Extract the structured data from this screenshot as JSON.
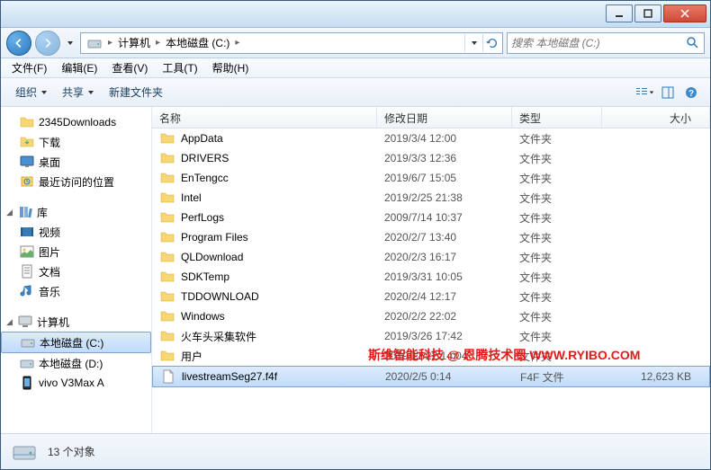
{
  "window_controls": {
    "min": "min",
    "max": "max",
    "close": "close"
  },
  "breadcrumb": {
    "root_sep": "▸",
    "computer": "计算机",
    "drive": "本地磁盘 (C:)"
  },
  "search": {
    "placeholder": "搜索 本地磁盘 (C:)"
  },
  "menubar": [
    "文件(F)",
    "编辑(E)",
    "查看(V)",
    "工具(T)",
    "帮助(H)"
  ],
  "toolbar": {
    "organize": "组织",
    "share": "共享",
    "new_folder": "新建文件夹"
  },
  "sidebar": {
    "group1": [
      {
        "icon": "folder",
        "label": "2345Downloads"
      },
      {
        "icon": "folder-dl",
        "label": "下载"
      },
      {
        "icon": "desktop",
        "label": "桌面"
      },
      {
        "icon": "recent",
        "label": "最近访问的位置"
      }
    ],
    "lib_header": "库",
    "libs": [
      {
        "icon": "video",
        "label": "视频"
      },
      {
        "icon": "pic",
        "label": "图片"
      },
      {
        "icon": "doc",
        "label": "文档"
      },
      {
        "icon": "music",
        "label": "音乐"
      }
    ],
    "computer_header": "计算机",
    "drives": [
      {
        "icon": "drive",
        "label": "本地磁盘 (C:)",
        "selected": true
      },
      {
        "icon": "drive",
        "label": "本地磁盘 (D:)"
      },
      {
        "icon": "phone",
        "label": "vivo V3Max A"
      }
    ]
  },
  "columns": {
    "name": "名称",
    "date": "修改日期",
    "type": "类型",
    "size": "大小"
  },
  "files": [
    {
      "name": "AppData",
      "date": "2019/3/4 12:00",
      "type": "文件夹",
      "size": "",
      "icon": "folder"
    },
    {
      "name": "DRIVERS",
      "date": "2019/3/3 12:36",
      "type": "文件夹",
      "size": "",
      "icon": "folder"
    },
    {
      "name": "EnTengcc",
      "date": "2019/6/7 15:05",
      "type": "文件夹",
      "size": "",
      "icon": "folder"
    },
    {
      "name": "Intel",
      "date": "2019/2/25 21:38",
      "type": "文件夹",
      "size": "",
      "icon": "folder"
    },
    {
      "name": "PerfLogs",
      "date": "2009/7/14 10:37",
      "type": "文件夹",
      "size": "",
      "icon": "folder"
    },
    {
      "name": "Program Files",
      "date": "2020/2/7 13:40",
      "type": "文件夹",
      "size": "",
      "icon": "folder"
    },
    {
      "name": "QLDownload",
      "date": "2020/2/3 16:17",
      "type": "文件夹",
      "size": "",
      "icon": "folder"
    },
    {
      "name": "SDKTemp",
      "date": "2019/3/31 10:05",
      "type": "文件夹",
      "size": "",
      "icon": "folder"
    },
    {
      "name": "TDDOWNLOAD",
      "date": "2020/2/4 12:17",
      "type": "文件夹",
      "size": "",
      "icon": "folder"
    },
    {
      "name": "Windows",
      "date": "2020/2/2 22:02",
      "type": "文件夹",
      "size": "",
      "icon": "folder"
    },
    {
      "name": "火车头采集软件",
      "date": "2019/3/26 17:42",
      "type": "文件夹",
      "size": "",
      "icon": "folder"
    },
    {
      "name": "用户",
      "date": "2019/11/22 14:04",
      "type": "文件夹",
      "size": "",
      "icon": "folder"
    },
    {
      "name": "livestreamSeg27.f4f",
      "date": "2020/2/5 0:14",
      "type": "F4F 文件",
      "size": "12,623 KB",
      "icon": "file",
      "selected": true
    }
  ],
  "watermark": "斯维智能科技 @ 恩腾技术圈 WWW.RYIBO.COM",
  "status": {
    "count": "13 个对象"
  }
}
